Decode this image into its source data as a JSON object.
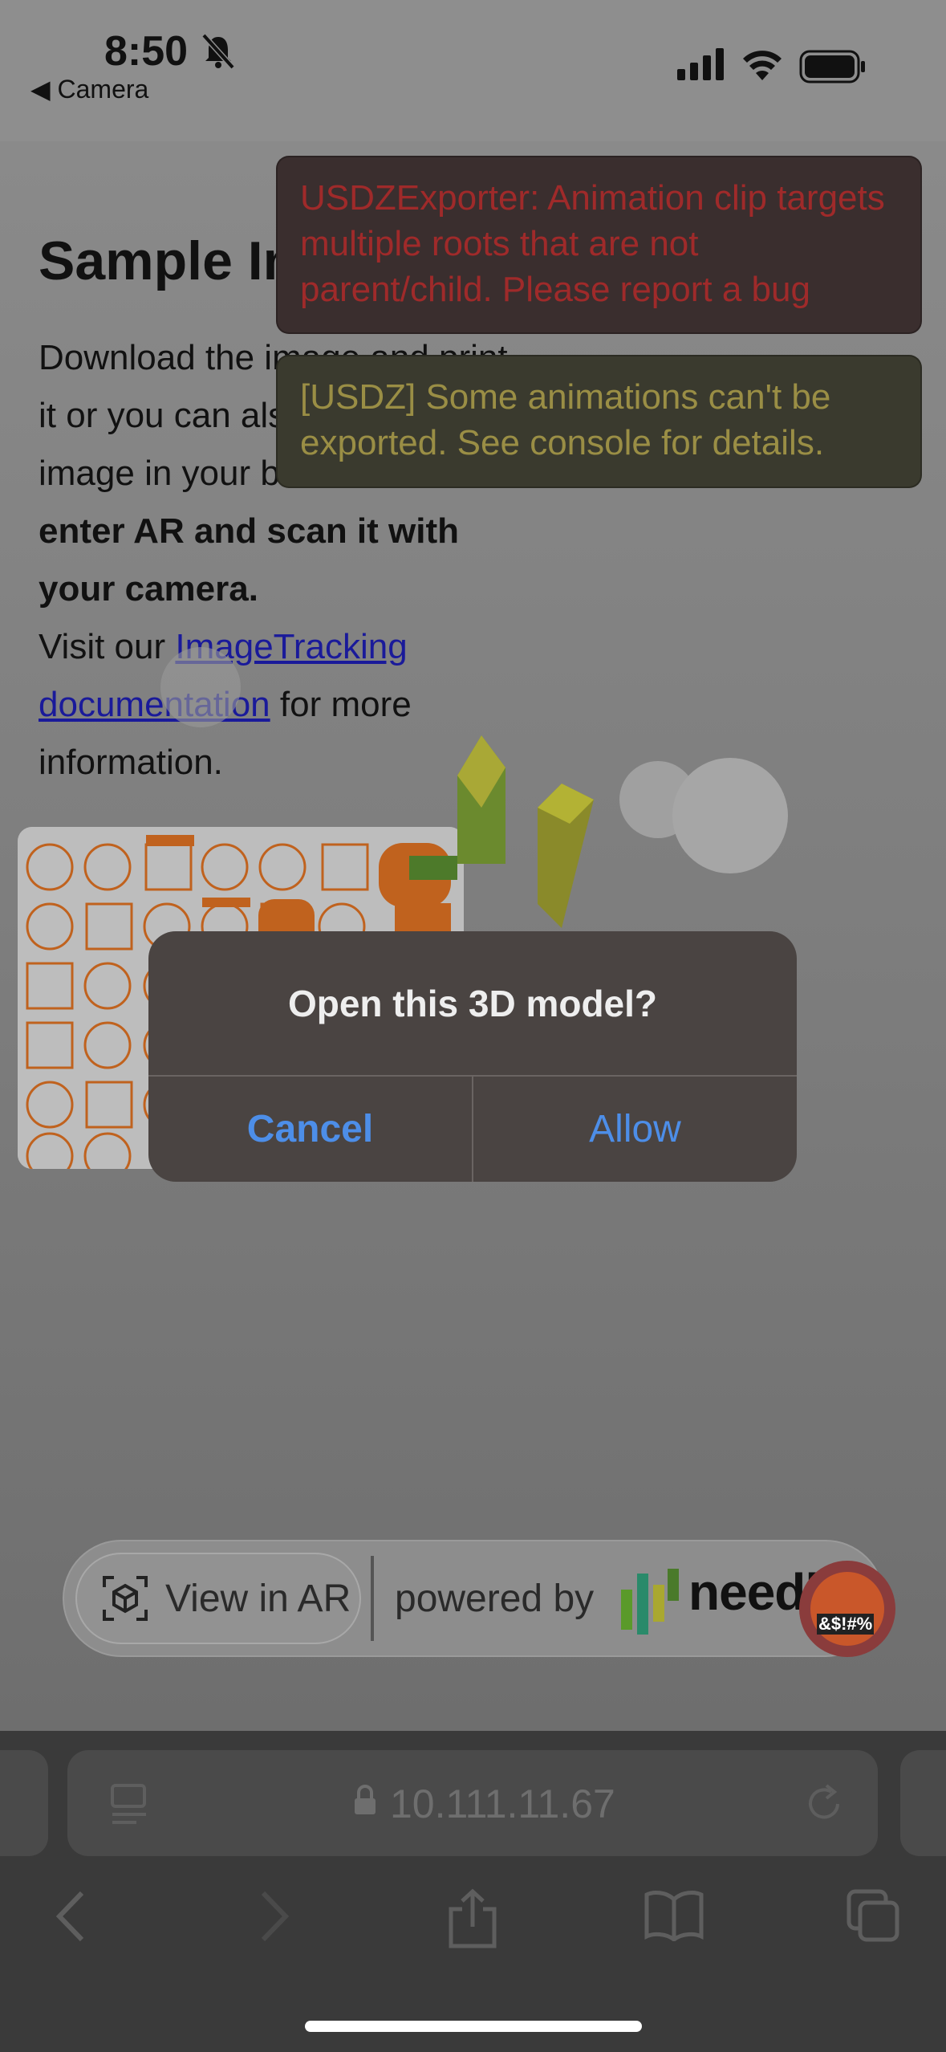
{
  "status_bar": {
    "time": "8:50",
    "back_app": "◀ Camera"
  },
  "page": {
    "heading": "Sample Image",
    "para_start": "Download the image and print it or you can also display the image in your browser.",
    "para_bold": "Then enter AR and scan it with your camera.",
    "visit": "Visit our ",
    "link": "ImageTracking documentation",
    "after_link": " for more information."
  },
  "toasts": {
    "error": "USDZExporter: Animation clip targets multiple roots that are not parent/child. Please report a bug",
    "warning": "[USDZ] Some animations can't be exported. See console for details."
  },
  "ar_bar": {
    "view_in_ar": "View in AR",
    "powered_by": "powered by",
    "brand": "needle",
    "emoji_badge": "&$!#%"
  },
  "dialog": {
    "title": "Open this 3D model?",
    "cancel": "Cancel",
    "allow": "Allow"
  },
  "browser": {
    "url": "10.111.11.67"
  },
  "colors": {
    "dialog_button": "#4d8ee8",
    "error_text": "#9f2a2a",
    "warning_text": "#9a8e45"
  }
}
